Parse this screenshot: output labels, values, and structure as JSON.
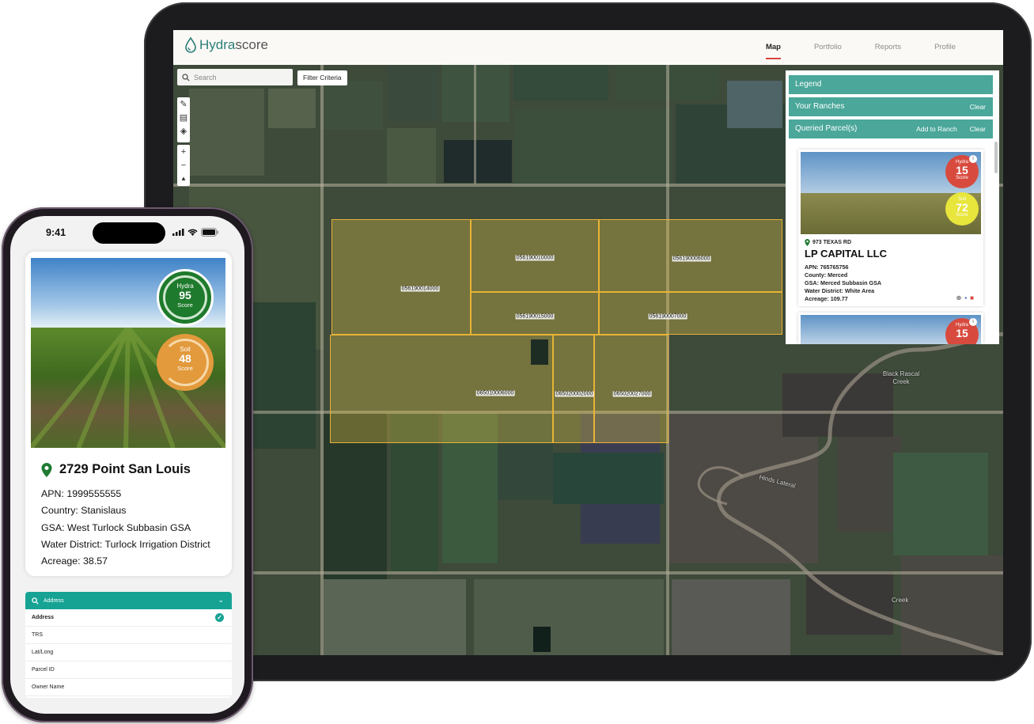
{
  "tablet": {
    "logo": {
      "part1": "Hydra",
      "part2": "score"
    },
    "nav": [
      "Map",
      "Portfolio",
      "Reports",
      "Profile"
    ],
    "active_tab": "Map",
    "search": {
      "placeholder": "Search"
    },
    "filter_label": "Filter Criteria",
    "map": {
      "parcels": [
        {
          "label": "056190014000"
        },
        {
          "label": "056190010000"
        },
        {
          "label": "056190006000"
        },
        {
          "label": "056190015000"
        },
        {
          "label": "056190007000"
        },
        {
          "label": "065010006000"
        },
        {
          "label": "065020002000"
        },
        {
          "label": "065020027000"
        }
      ],
      "place_labels": [
        "Black Rascal Creek",
        "Hinds Lateral",
        "Creek"
      ]
    },
    "panel": {
      "legend": "Legend",
      "your_ranches": "Your Ranches",
      "queried_parcels": "Queried Parcel(s)",
      "add_to_ranch": "Add to Ranch",
      "clear": "Clear",
      "card": {
        "hydra_label": "Hydra",
        "hydra_score": "15",
        "score_label": "Score",
        "soil_label": "Soil",
        "soil_score": "72",
        "address": "973 TEXAS RD",
        "owner": "LP CAPITAL LLC",
        "apn": "APN: 765765756",
        "county": "County: Merced",
        "gsa": "GSA: Merced Subbasin GSA",
        "water_district": "Water District: White Area",
        "acreage": "Acreage: 109.77"
      },
      "card2": {
        "hydra_label": "Hydra",
        "hydra_score": "15"
      }
    },
    "colors": {
      "teal": "#4aa79a",
      "accent_red": "#d9453d",
      "parcel_outline": "#e8b436"
    }
  },
  "phone": {
    "time": "9:41",
    "card": {
      "hydra_label": "Hydra",
      "hydra_score": "95",
      "hydra_score_label": "Score",
      "soil_label": "Soil",
      "soil_score": "48",
      "soil_score_label": "Score",
      "title": "2729 Point San Louis",
      "apn": "APN: 1999555555",
      "country": "Country: Stanislaus",
      "gsa": "GSA: West Turlock Subbasin GSA",
      "water_district": "Water District: Turlock Irrigation District",
      "acreage": "Acreage: 38.57"
    },
    "search_by": {
      "selected": "Address",
      "options": [
        "Address",
        "TRS",
        "Lat/Long",
        "Parcel ID",
        "Owner Name"
      ]
    },
    "colors": {
      "hydra_green": "#1e7a2c",
      "soil_orange": "#e29a3c",
      "teal": "#16a394"
    }
  }
}
